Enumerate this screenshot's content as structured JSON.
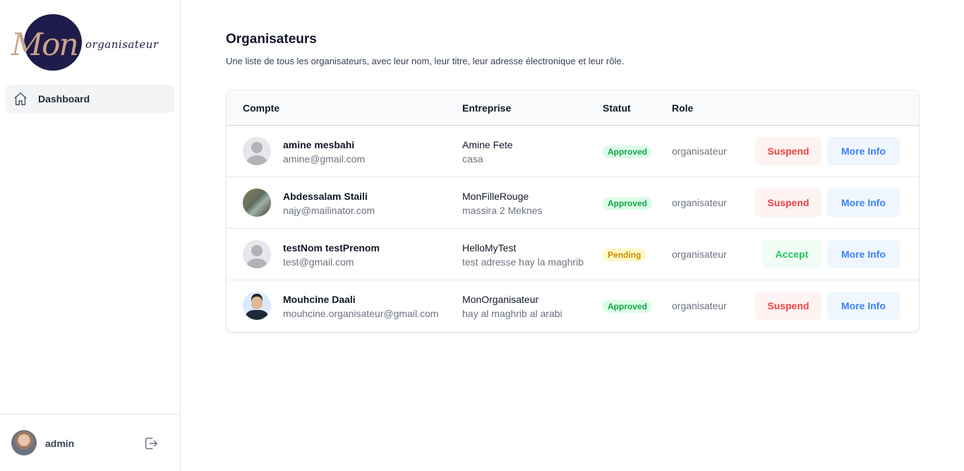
{
  "brand": {
    "script": "Mon",
    "word": "organisateur"
  },
  "sidebar": {
    "items": [
      {
        "label": "Dashboard",
        "icon": "home-icon"
      }
    ]
  },
  "user": {
    "name": "admin",
    "logout_icon": "logout-icon"
  },
  "page": {
    "title": "Organisateurs",
    "subtitle": "Une liste de tous les organisateurs, avec leur nom, leur titre, leur adresse électronique et leur rôle."
  },
  "table": {
    "headers": {
      "account": "Compte",
      "company": "Entreprise",
      "status": "Statut",
      "role": "Role"
    },
    "rows": [
      {
        "name": "amine mesbahi",
        "email": "amine@gmail.com",
        "company": "Amine Fete",
        "address": "casa",
        "status": "Approved",
        "role": "organisateur",
        "action": "Suspend",
        "info": "More Info"
      },
      {
        "name": "Abdessalam Staili",
        "email": "najy@mailinator.com",
        "company": "MonFilleRouge",
        "address": "massira 2 Meknes",
        "status": "Approved",
        "role": "organisateur",
        "action": "Suspend",
        "info": "More Info"
      },
      {
        "name": "testNom testPrenom",
        "email": "test@gmail.com",
        "company": "HelloMyTest",
        "address": "test adresse hay la maghrib",
        "status": "Pending",
        "role": "organisateur",
        "action": "Accept",
        "info": "More Info"
      },
      {
        "name": "Mouhcine Daali",
        "email": "mouhcine.organisateur@gmail.com",
        "company": "MonOrganisateur",
        "address": "hay al maghrib al arabi",
        "status": "Approved",
        "role": "organisateur",
        "action": "Suspend",
        "info": "More Info"
      }
    ]
  },
  "colors": {
    "approved": "#16a34a",
    "pending": "#ca8a04",
    "suspend": "#ef4444",
    "accept": "#22c55e",
    "info": "#3b82f6",
    "brand": "#1f1b4a"
  }
}
